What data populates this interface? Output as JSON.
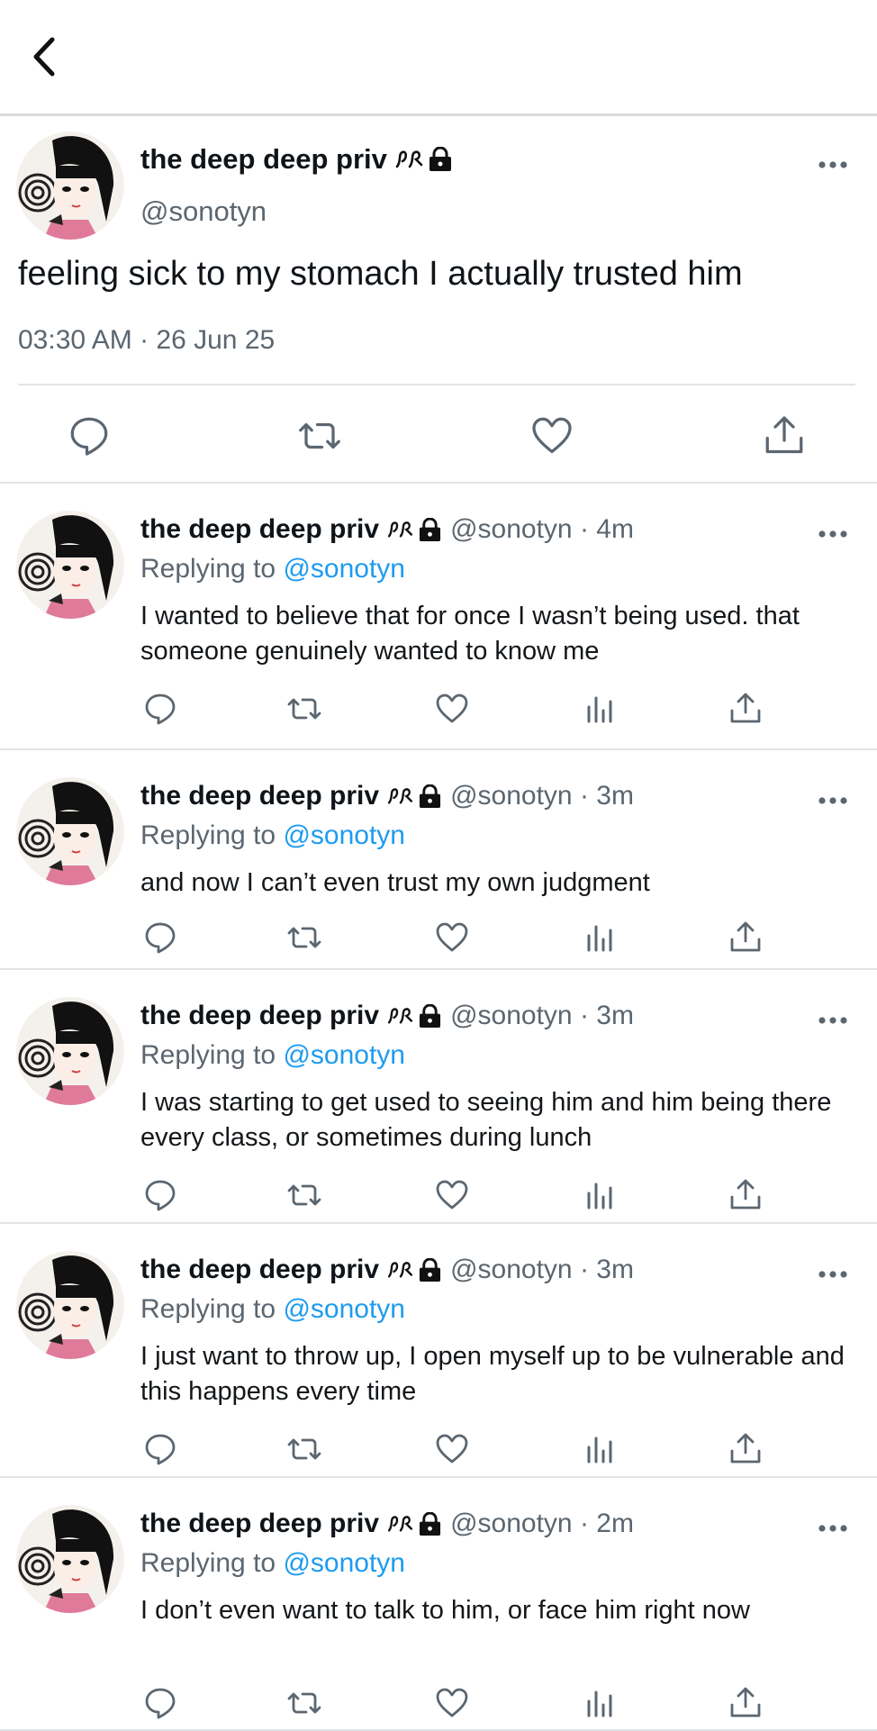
{
  "main_tweet": {
    "display_name": "the deep deep priv",
    "handle": "@sonotyn",
    "text": "feeling sick to my stomach I actually trusted him",
    "timestamp": "03:30 AM · 26 Jun 25"
  },
  "replies": [
    {
      "display_name": "the deep deep priv",
      "handle_time": "@sonotyn · 4m",
      "replying_prefix": "Replying to",
      "replying_to": "@sonotyn",
      "text": "I wanted to believe that for once I wasn’t being used. that someone genuinely wanted to know me"
    },
    {
      "display_name": "the deep deep priv",
      "handle_time": "@sonotyn · 3m",
      "replying_prefix": "Replying to",
      "replying_to": "@sonotyn",
      "text": "and now I can’t even trust my own judgment"
    },
    {
      "display_name": "the deep deep priv",
      "handle_time": "@sonotyn · 3m",
      "replying_prefix": "Replying to",
      "replying_to": "@sonotyn",
      "text": "I was starting to get used to seeing him and him being there every class, or sometimes during lunch"
    },
    {
      "display_name": "the deep deep priv",
      "handle_time": "@sonotyn · 3m",
      "replying_prefix": "Replying to",
      "replying_to": "@sonotyn",
      "text": "I just want to throw up, I open myself up to be vulnerable and this happens every time"
    },
    {
      "display_name": "the deep deep priv",
      "handle_time": "@sonotyn · 2m",
      "replying_prefix": "Replying to",
      "replying_to": "@sonotyn",
      "text": "I don’t even want to talk to him, or face him right now"
    }
  ],
  "icons": {
    "back": "chevron-left-icon",
    "badges": [
      "knot-glyph-icon",
      "lock-icon"
    ],
    "actions": [
      "reply-icon",
      "retweet-icon",
      "like-icon",
      "analytics-icon",
      "share-icon"
    ],
    "more": "more-options-icon"
  },
  "colors": {
    "mention": "#1d9bf0",
    "secondary_text": "#5b6670",
    "divider": "#e1e4e7"
  }
}
